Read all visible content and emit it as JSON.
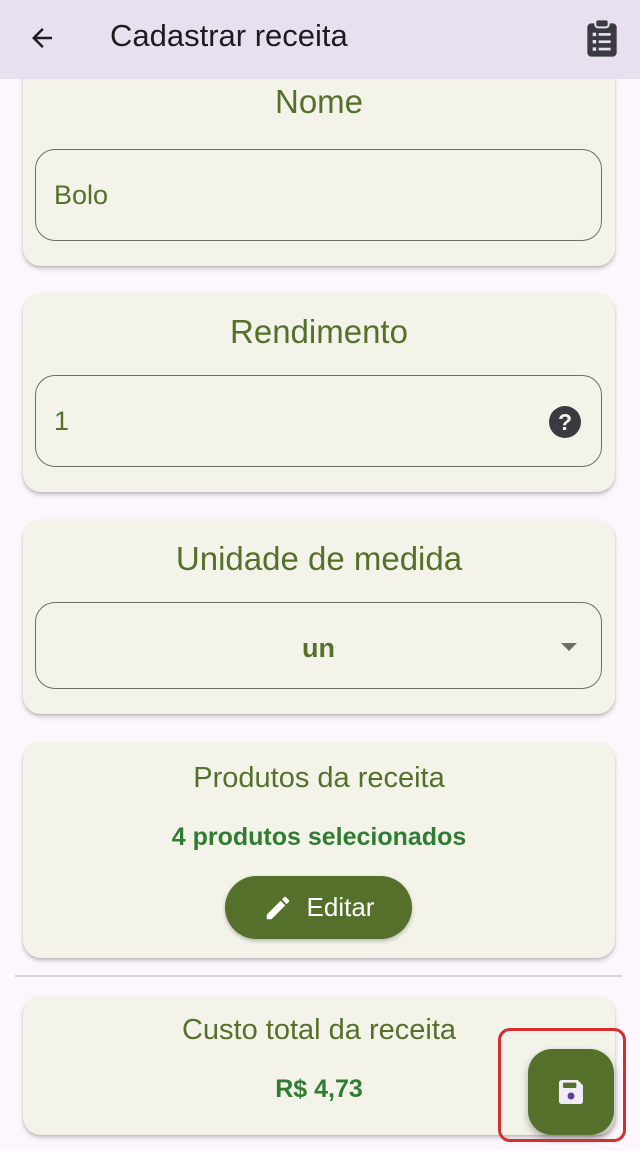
{
  "appbar": {
    "title": "Cadastrar receita",
    "back_icon": "arrow-left-icon",
    "action_icon": "clipboard-list-icon"
  },
  "nome": {
    "heading": "Nome",
    "value": "Bolo"
  },
  "rendimento": {
    "heading": "Rendimento",
    "value": "1",
    "help_icon": "question-circle-icon"
  },
  "unidade": {
    "heading": "Unidade de medida",
    "value": "un"
  },
  "produtos": {
    "heading": "Produtos da receita",
    "selected_text": "4 produtos selecionados",
    "edit_label": "Editar"
  },
  "custo": {
    "heading": "Custo total da receita",
    "value": "R$ 4,73"
  },
  "fab": {
    "icon": "save-icon"
  },
  "colors": {
    "primary": "#55702a",
    "appbar_bg": "#e8e0ef",
    "card_bg": "#f4f3ea",
    "accent_text": "#2f7d32",
    "highlight": "#d32f2f"
  }
}
